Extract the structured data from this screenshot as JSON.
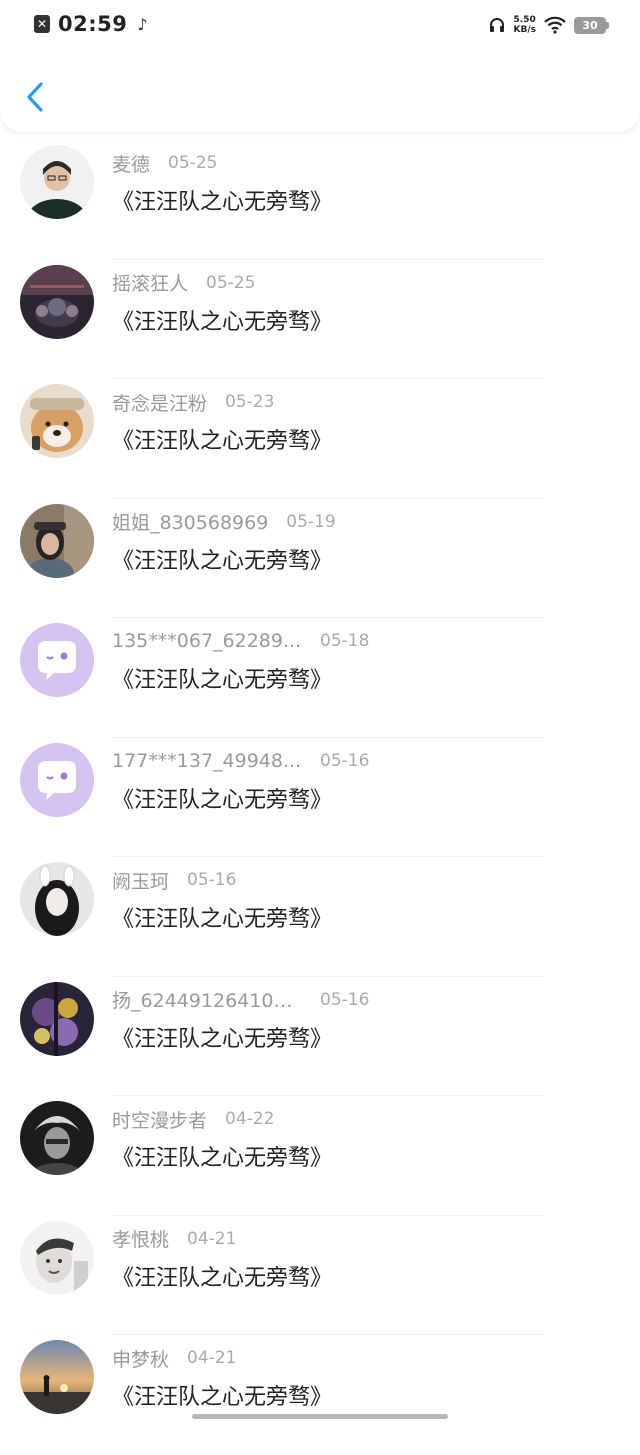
{
  "status_bar": {
    "time": "02:59",
    "net_speed_value": "5.50",
    "net_speed_unit": "KB/s",
    "battery": "30",
    "notification_icon": "close-box-icon",
    "music_icon": "music-note-icon"
  },
  "header": {
    "back_icon": "chevron-left-icon",
    "accent_color": "#2b9be6"
  },
  "items": [
    {
      "name": "麦德",
      "date": "05-25",
      "title": "《汪汪队之心无旁骛》",
      "avatar": "photo"
    },
    {
      "name": "摇滚狂人",
      "date": "05-25",
      "title": "《汪汪队之心无旁骛》",
      "avatar": "photo"
    },
    {
      "name": "奇念是汪粉",
      "date": "05-23",
      "title": "《汪汪队之心无旁骛》",
      "avatar": "photo"
    },
    {
      "name": "姐姐_830568969",
      "date": "05-19",
      "title": "《汪汪队之心无旁骛》",
      "avatar": "photo"
    },
    {
      "name": "135***067_62289...",
      "date": "05-18",
      "title": "《汪汪队之心无旁骛》",
      "avatar": "default-chat-bubble"
    },
    {
      "name": "177***137_49948...",
      "date": "05-16",
      "title": "《汪汪队之心无旁骛》",
      "avatar": "default-chat-bubble"
    },
    {
      "name": "阙玉珂",
      "date": "05-16",
      "title": "《汪汪队之心无旁骛》",
      "avatar": "photo"
    },
    {
      "name": "扬_624491264103...",
      "date": "05-16",
      "title": "《汪汪队之心无旁骛》",
      "avatar": "photo"
    },
    {
      "name": "时空漫步者",
      "date": "04-22",
      "title": "《汪汪队之心无旁骛》",
      "avatar": "photo"
    },
    {
      "name": "孝恨桃",
      "date": "04-21",
      "title": "《汪汪队之心无旁骛》",
      "avatar": "photo"
    },
    {
      "name": "申梦秋",
      "date": "04-21",
      "title": "《汪汪队之心无旁骛》",
      "avatar": "photo"
    }
  ]
}
